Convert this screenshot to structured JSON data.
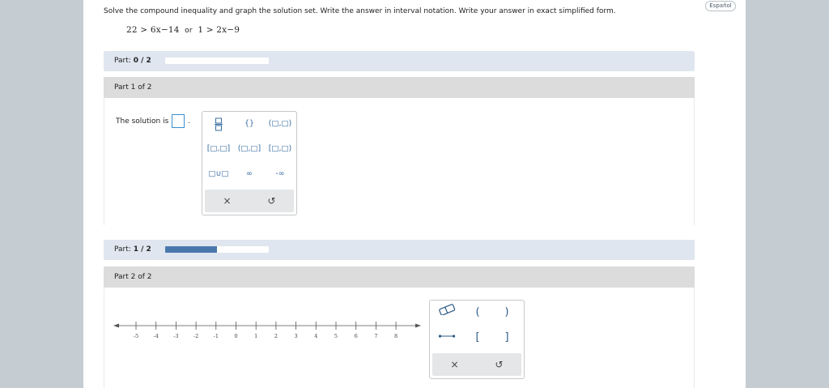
{
  "header": {
    "language_button": "Español"
  },
  "problem": {
    "instructions": "Solve the compound inequality and graph the solution set. Write the answer in interval notation. Write your answer in exact simplified form.",
    "expr_left": "22 > 6x−14",
    "expr_or": "or",
    "expr_right": "1 > 2x−9"
  },
  "progress_top": {
    "label": "Part:",
    "value": "0 / 2",
    "fraction": 0
  },
  "part1": {
    "title": "Part 1 of 2",
    "prompt": "The solution is",
    "prompt_suffix": ".",
    "palette": {
      "fraction": "□/□",
      "braces": "{}",
      "open_open": "(□,□)",
      "closed_closed": "[□,□]",
      "open_closed": "(□,□]",
      "closed_open": "[□,□)",
      "union": "□∪□",
      "infinity": "∞",
      "neg_infinity": "-∞",
      "clear": "×",
      "undo": "↺"
    }
  },
  "progress_mid": {
    "label": "Part:",
    "value": "1 / 2",
    "fraction": 0.5
  },
  "part2": {
    "title": "Part 2 of 2",
    "number_line": {
      "ticks": [
        "-5",
        "-4",
        "-3",
        "-2",
        "-1",
        "0",
        "1",
        "2",
        "3",
        "4",
        "5",
        "6",
        "7",
        "8"
      ]
    },
    "graph_palette": {
      "open_paren": "(",
      "close_paren": ")",
      "open_bracket": "[",
      "close_bracket": "]",
      "clear": "×",
      "undo": "↺",
      "eraser_icon": "eraser-icon",
      "segment_icon": "segment-icon"
    }
  }
}
